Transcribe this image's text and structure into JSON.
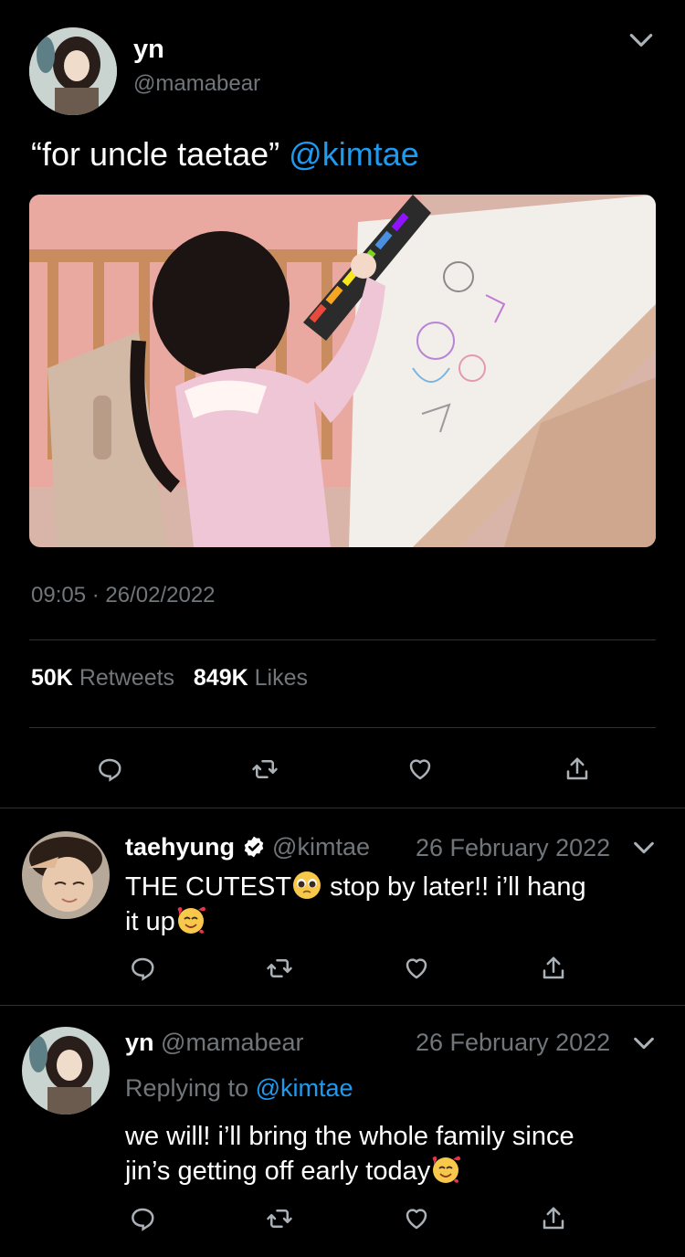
{
  "main_tweet": {
    "author_name": "yn",
    "author_handle": "@mamabear",
    "text_prefix": "“for uncle taetae”",
    "mention": "@kimtae",
    "time": "09:05",
    "date": "26/02/2022",
    "retweets_count": "50K",
    "retweets_label": "Retweets",
    "likes_count": "849K",
    "likes_label": "Likes"
  },
  "reply1": {
    "author_name": "taehyung",
    "author_handle": "@kimtae",
    "date": "26 February 2022",
    "text_a": "THE CUTEST",
    "text_b": " stop by later!! i’ll hang",
    "text_c": "it up",
    "verified": true
  },
  "reply2": {
    "author_name": "yn",
    "author_handle": "@mamabear",
    "date": "26 February 2022",
    "replying_prefix": "Replying to",
    "replying_to": "@kimtae",
    "text_a": "we will! i’ll bring the whole family since",
    "text_b": "jin’s getting off early today"
  },
  "colors": {
    "accent": "#1d9bf0",
    "muted": "#71767b",
    "divider": "#2f3336",
    "background": "#000000"
  },
  "icons": [
    "chevron-down-icon",
    "reply-icon",
    "retweet-icon",
    "like-icon",
    "share-icon",
    "verified-icon",
    "pleading-face-emoji",
    "smiling-hearts-emoji"
  ]
}
